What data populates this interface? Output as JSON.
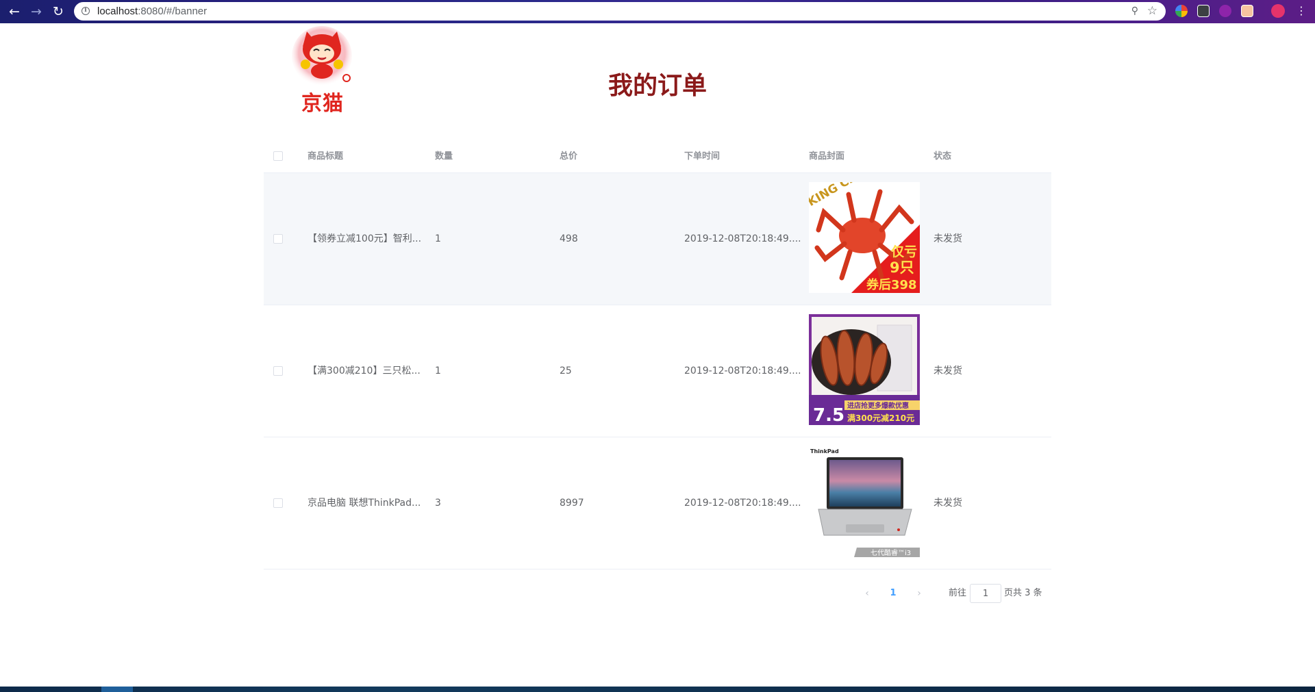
{
  "browser": {
    "url_host": "localhost",
    "url_path": ":8080/#/banner"
  },
  "header": {
    "logo_text": "京猫",
    "title": "我的订单"
  },
  "table": {
    "columns": [
      "商品标题",
      "数量",
      "总价",
      "下单时间",
      "商品封面",
      "状态"
    ],
    "rows": [
      {
        "title": "【领券立减100元】智利...",
        "quantity": "1",
        "total": "498",
        "time": "2019-12-08T20:18:49....",
        "cover": {
          "text_top": "KING CRAB",
          "text_a": "仅亏",
          "text_b": "9只",
          "text_c": "券后398"
        },
        "status": "未发货"
      },
      {
        "title": "【满300减210】三只松...",
        "quantity": "1",
        "total": "25",
        "time": "2019-12-08T20:18:49....",
        "cover": {
          "text_a": "7.5",
          "text_b": "进店抢更多爆款优惠",
          "text_c": "满300元减210元"
        },
        "status": "未发货"
      },
      {
        "title": "京品电脑 联想ThinkPad...",
        "quantity": "3",
        "total": "8997",
        "time": "2019-12-08T20:18:49....",
        "cover": {
          "text_top": "ThinkPad",
          "text_a": "七代酷睿™i3"
        },
        "status": "未发货"
      }
    ]
  },
  "pagination": {
    "current_page": "1",
    "jump_label": "前往",
    "jump_value": "1",
    "total_label": "页共 3 条"
  }
}
